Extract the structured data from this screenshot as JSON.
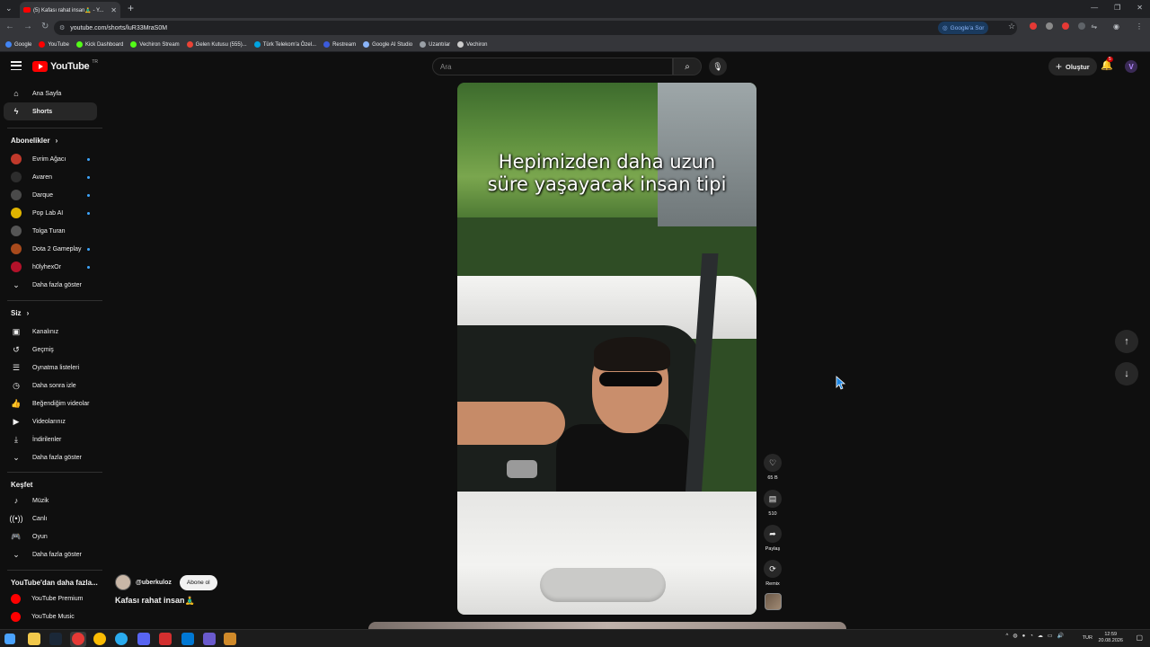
{
  "browser": {
    "tab_title": "(5) Kafası rahat insan🧘‍♂️ - Y...",
    "url": "youtube.com/shorts/luR33MraS0M",
    "ask_google": "Google'a Sor",
    "bookmarks": [
      "Google",
      "YouTube",
      "Kick Dashboard",
      "Vechiron Stream",
      "Gelen Kutusu (555)...",
      "Türk Telekom'a Özel...",
      "Restream",
      "Google AI Studio",
      "Uzantılar",
      "Vechiron"
    ]
  },
  "header": {
    "logo_text": "YouTube",
    "logo_country": "TR",
    "search_placeholder": "Ara",
    "create_label": "Oluştur",
    "notification_count": "5",
    "avatar_letter": "V"
  },
  "sidebar": {
    "main": [
      {
        "label": "Ana Sayfa",
        "icon": "home-icon"
      },
      {
        "label": "Shorts",
        "icon": "shorts-icon"
      }
    ],
    "subs_title": "Abonelikler",
    "subscriptions": [
      {
        "label": "Evrim Ağacı",
        "color": "#c0392b"
      },
      {
        "label": "Avaren",
        "color": "#2d2d2d"
      },
      {
        "label": "Darque",
        "color": "#4a4a4a"
      },
      {
        "label": "Pop Lab AI",
        "color": "#e0b400"
      },
      {
        "label": "Tolga Turan",
        "color": "#555555"
      },
      {
        "label": "Dota 2 Gameplay",
        "color": "#a84a1c"
      },
      {
        "label": "h0lyhexOr",
        "color": "#b3122a"
      }
    ],
    "subs_more": "Daha fazla göster",
    "you_title": "Siz",
    "you_items": [
      {
        "label": "Kanalınız",
        "icon": "channel-icon"
      },
      {
        "label": "Geçmiş",
        "icon": "history-icon"
      },
      {
        "label": "Oynatma listeleri",
        "icon": "playlist-icon"
      },
      {
        "label": "Daha sonra izle",
        "icon": "clock-icon"
      },
      {
        "label": "Beğendiğim videolar",
        "icon": "like-icon"
      },
      {
        "label": "Videolarınız",
        "icon": "video-icon"
      },
      {
        "label": "İndirilenler",
        "icon": "download-icon"
      },
      {
        "label": "Daha fazla göster",
        "icon": "chevron-down-icon"
      }
    ],
    "explore_title": "Keşfet",
    "explore_items": [
      {
        "label": "Müzik",
        "icon": "music-icon"
      },
      {
        "label": "Canlı",
        "icon": "live-icon"
      },
      {
        "label": "Oyun",
        "icon": "gaming-icon"
      },
      {
        "label": "Daha fazla göster",
        "icon": "chevron-down-icon"
      }
    ],
    "more_title": "YouTube'dan daha fazla...",
    "more_items": [
      {
        "label": "YouTube Premium"
      },
      {
        "label": "YouTube Music"
      }
    ]
  },
  "short": {
    "caption_line1": "Hepimizden daha uzun",
    "caption_line2": "süre yaşayacak insan tipi",
    "channel": "@uberkuloz",
    "subscribe_label": "Abone ol",
    "title": "Kafası rahat insan🧘‍♂️",
    "likes": "65 B",
    "comments": "510",
    "share_label": "Paylaş",
    "remix_label": "Remix"
  },
  "taskbar": {
    "lang": "TUR",
    "time": "12:59",
    "date": "20.08.2026"
  }
}
